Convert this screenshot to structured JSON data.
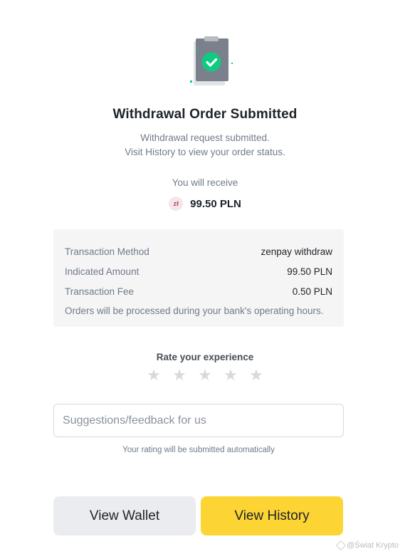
{
  "header": {
    "title": "Withdrawal Order Submitted",
    "subtitle_line1": "Withdrawal request submitted.",
    "subtitle_line2": "Visit History to view your order status."
  },
  "receive": {
    "label": "You will receive",
    "currency_symbol": "zł",
    "amount": "99.50 PLN"
  },
  "details": {
    "rows": [
      {
        "label": "Transaction Method",
        "value": "zenpay withdraw"
      },
      {
        "label": "Indicated Amount",
        "value": "99.50 PLN"
      },
      {
        "label": "Transaction Fee",
        "value": "0.50 PLN"
      }
    ],
    "note": "Orders will be processed during your bank's operating hours."
  },
  "rating": {
    "label": "Rate your experience",
    "max_stars": 5,
    "selected_stars": 0
  },
  "feedback": {
    "placeholder": "Suggestions/feedback for us",
    "value": "",
    "auto_note": "Your rating will be submitted automatically"
  },
  "actions": {
    "wallet_label": "View Wallet",
    "history_label": "View History"
  },
  "watermark": {
    "text": "@Świat Krypto"
  },
  "colors": {
    "accent": "#fcd535",
    "success": "#0ecb81",
    "secondary_button": "#eaecef",
    "panel": "#f5f5f5"
  },
  "icons": {
    "hero": "clipboard-check-icon",
    "currency": "pln-currency-icon",
    "star": "star-icon"
  }
}
